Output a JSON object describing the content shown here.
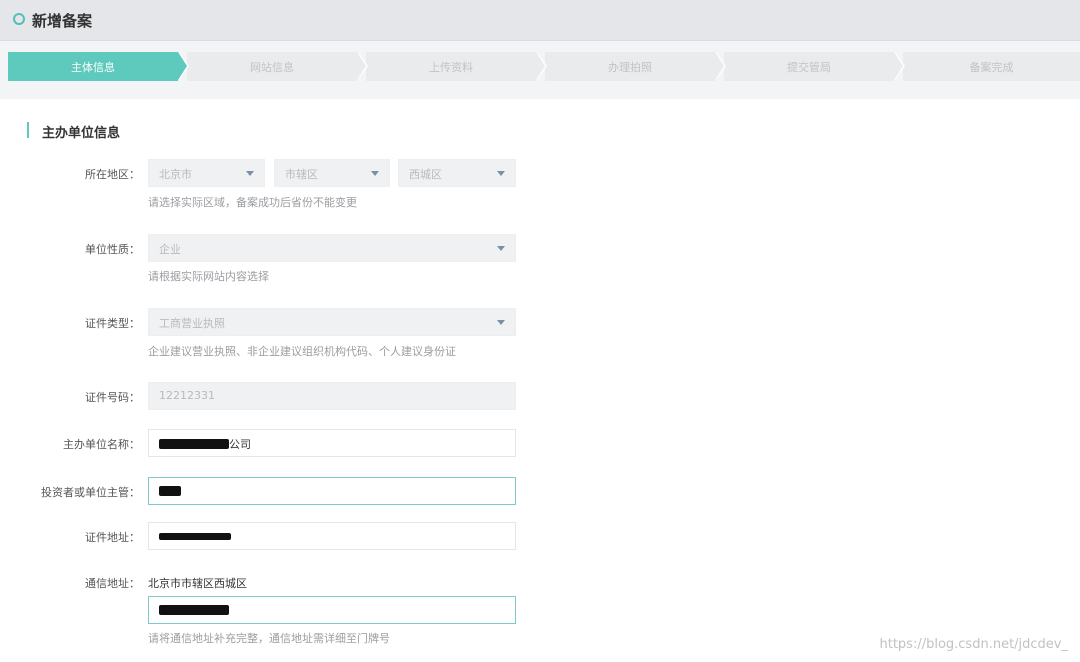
{
  "header": {
    "title": "新增备案"
  },
  "steps": [
    {
      "label": "主体信息",
      "active": true
    },
    {
      "label": "网站信息",
      "active": false
    },
    {
      "label": "上传资料",
      "active": false
    },
    {
      "label": "办理拍照",
      "active": false
    },
    {
      "label": "提交管局",
      "active": false
    },
    {
      "label": "备案完成",
      "active": false
    }
  ],
  "section": {
    "title": "主办单位信息"
  },
  "form": {
    "region": {
      "label": "所在地区：",
      "province": "北京市",
      "city": "市辖区",
      "district": "西城区",
      "hint": "请选择实际区域，备案成功后省份不能变更"
    },
    "unit_type": {
      "label": "单位性质：",
      "value": "企业",
      "hint": "请根据实际网站内容选择"
    },
    "cert_type": {
      "label": "证件类型：",
      "value": "工商营业执照",
      "hint": "企业建议营业执照、非企业建议组织机构代码、个人建议身份证"
    },
    "cert_number": {
      "label": "证件号码：",
      "value": "12212331"
    },
    "org_name": {
      "label": "主办单位名称：",
      "suffix": "公司"
    },
    "investor": {
      "label": "投资者或单位主管："
    },
    "cert_address": {
      "label": "证件地址："
    },
    "mail_address": {
      "label": "通信地址：",
      "prefix": "北京市市辖区西城区",
      "hint": "请将通信地址补充完整，通信地址需详细至门牌号"
    }
  },
  "watermark": "https://blog.csdn.net/jdcdev_"
}
